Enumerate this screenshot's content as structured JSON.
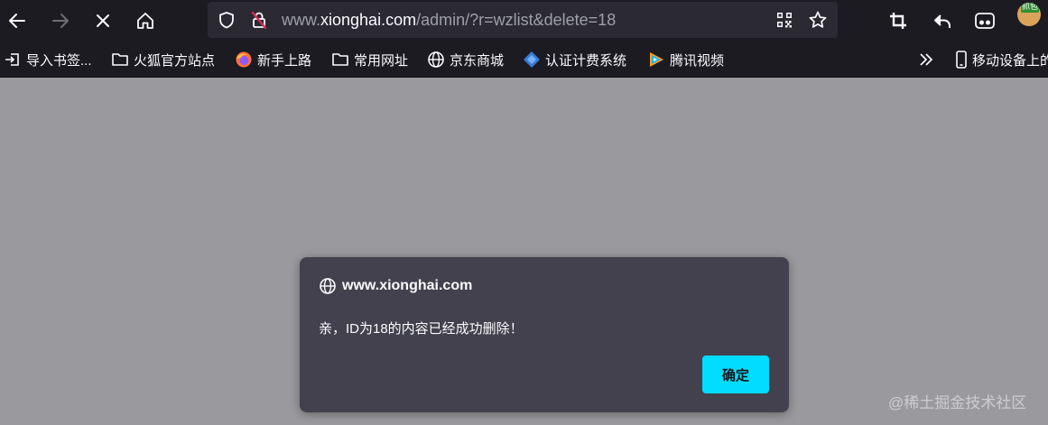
{
  "browser": {
    "url_prefix": "www.",
    "url_host": "xionghai.com",
    "url_path": "/admin/?r=wzlist&delete=18"
  },
  "icons": {
    "back": "back-arrow-icon",
    "forward": "forward-arrow-icon",
    "stop": "stop-icon",
    "home": "home-icon",
    "tracking": "shield-icon",
    "insecure": "insecure-lock-icon",
    "qr": "qr-code-icon",
    "bookmark": "star-icon",
    "screenshot": "crop-icon",
    "undo": "undo-icon",
    "extensions": "mask-icon"
  },
  "profile": {
    "badge": "抓包"
  },
  "bookmarks": {
    "items": [
      {
        "label": "导入书签...",
        "icon": "import-icon"
      },
      {
        "label": "火狐官方站点",
        "icon": "folder-icon"
      },
      {
        "label": "新手上路",
        "icon": "firefox-icon"
      },
      {
        "label": "常用网址",
        "icon": "folder-icon"
      },
      {
        "label": "京东商城",
        "icon": "globe-icon"
      },
      {
        "label": "认证计费系统",
        "icon": "diamond-icon"
      },
      {
        "label": "腾讯视频",
        "icon": "video-icon"
      }
    ],
    "overflow_icon": "chevron-double-right-icon",
    "mobile_label": "移动设备上的"
  },
  "dialog": {
    "origin": "www.xionghai.com",
    "message": "亲，ID为18的内容已经成功删除！",
    "ok_label": "确定"
  },
  "watermark": "@稀土掘金技术社区",
  "colors": {
    "chrome_bg": "#1c1b22",
    "urlbar_bg": "#2b2a33",
    "page_overlay": "#9a9a9e",
    "dialog_bg": "#42414d",
    "accent": "#00ddff",
    "insecure_red": "#e22850"
  }
}
